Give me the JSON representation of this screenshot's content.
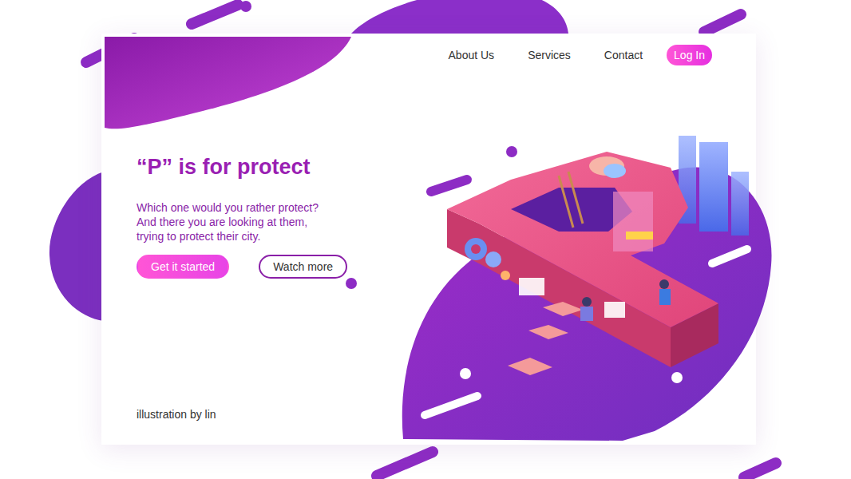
{
  "nav": {
    "items": [
      {
        "label": "About Us"
      },
      {
        "label": "Services"
      },
      {
        "label": "Contact"
      }
    ],
    "login": "Log In"
  },
  "hero": {
    "title": "“P” is for protect",
    "lines": [
      "Which one would you rather protect?",
      "And there you are looking at them,",
      "trying to protect their city."
    ],
    "buttons": [
      {
        "label": "Get it started",
        "kind": "filled"
      },
      {
        "label": "Watch more",
        "kind": "outline"
      }
    ]
  },
  "credit": "illustration by lin"
}
